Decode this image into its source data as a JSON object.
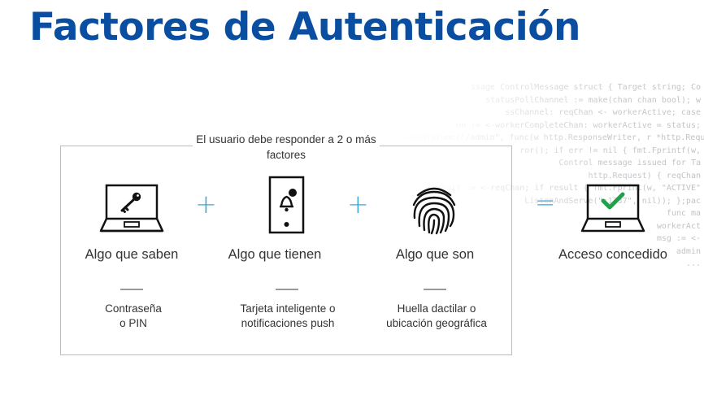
{
  "title": "Factores de Autenticación",
  "frame_caption": "El usuario debe responder a 2 o más factores",
  "factors": [
    {
      "label": "Algo que saben",
      "desc_line1": "Contraseña",
      "desc_line2": "o PIN",
      "icon": "laptop-key-icon"
    },
    {
      "label": "Algo que tienen",
      "desc_line1": "Tarjeta inteligente o",
      "desc_line2": "notificaciones push",
      "icon": "smartphone-notification-icon"
    },
    {
      "label": "Algo que son",
      "desc_line1": "Huella dactilar o",
      "desc_line2": "ubicación geográfica",
      "icon": "fingerprint-icon"
    }
  ],
  "operators": {
    "plus": "+",
    "equals": "="
  },
  "result": {
    "label": "Acceso concedido",
    "icon": "laptop-check-icon"
  },
  "code_lines": [
    "ssage ControlMessage struct { Target string; Co",
    "statusPollChannel := make(chan chan bool); w",
    "ssChannel: reqChan <- workerActive; case",
    "on := <-workerCompleteChan: workerActive = status;",
    "http.HandleFunc(\"/admin\", func(w http.ResponseWriter, r *http.Request) { hostTo",
    "ror(); if err != nil { fmt.Fprintf(w,",
    "Control message issued for Ta",
    "http.Request) { reqChan",
    "result := <-reqChan; if result { fmt.Fprint(w, \"ACTIVE\"",
    "ListenAndServe(\":1337\", nil)); };pac",
    "func ma",
    "workerAct",
    "msg := <-",
    "admin",
    "..."
  ],
  "colors": {
    "title": "#0a4ea2",
    "operator": "#3aa7d6",
    "check": "#1fa24a",
    "frame": "#b9bcc0"
  }
}
